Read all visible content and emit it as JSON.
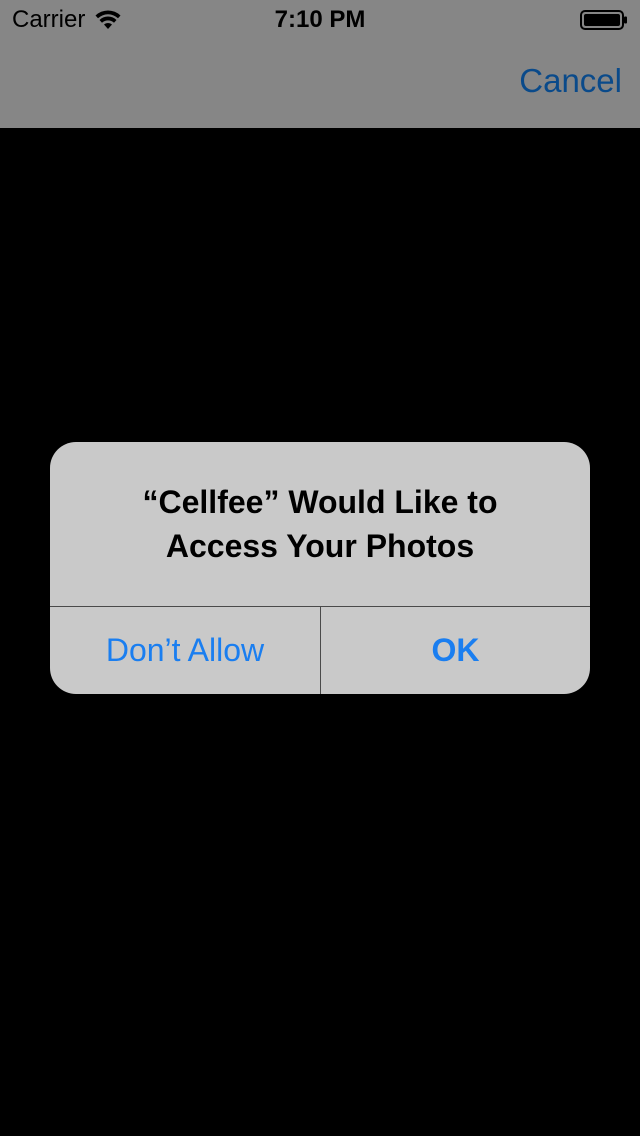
{
  "status_bar": {
    "carrier": "Carrier",
    "time": "7:10 PM",
    "wifi_icon": "wifi-icon",
    "battery_icon": "battery-icon"
  },
  "nav_bar": {
    "cancel_label": "Cancel"
  },
  "alert": {
    "title_line1": "“Cellfee” Would Like to",
    "title_line2": "Access Your Photos",
    "dont_allow_label": "Don’t Allow",
    "ok_label": "OK"
  },
  "colors": {
    "alert_background": "#c9c9c9",
    "button_text": "#1a7ef0",
    "dimmed_nav": "#868686",
    "cancel_text": "#0a4a8a"
  }
}
